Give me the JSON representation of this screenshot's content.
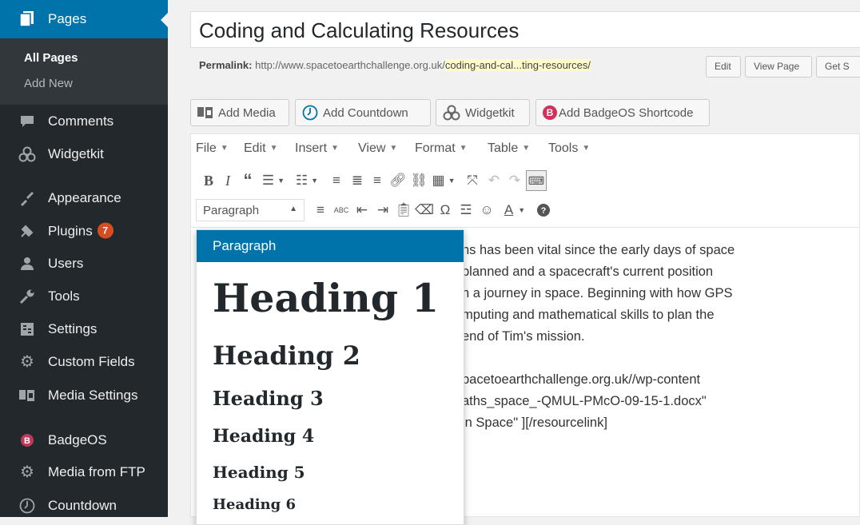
{
  "sidebar": {
    "pages_label": "Pages",
    "submenu": {
      "all_pages": "All Pages",
      "add_new": "Add New"
    },
    "items": [
      {
        "label": "Comments",
        "icon": "comments-icon"
      },
      {
        "label": "Widgetkit",
        "icon": "widgetkit-icon"
      },
      {
        "label": "Appearance",
        "icon": "appearance-icon"
      },
      {
        "label": "Plugins",
        "icon": "plugins-icon",
        "badge": "7"
      },
      {
        "label": "Users",
        "icon": "users-icon"
      },
      {
        "label": "Tools",
        "icon": "tools-icon"
      },
      {
        "label": "Settings",
        "icon": "settings-icon"
      },
      {
        "label": "Custom Fields",
        "icon": "gear-icon"
      },
      {
        "label": "Media Settings",
        "icon": "media-icon"
      },
      {
        "label": "BadgeOS",
        "icon": "badgeos-icon"
      },
      {
        "label": "Media from FTP",
        "icon": "gear-icon"
      },
      {
        "label": "Countdown",
        "icon": "clock-icon"
      }
    ]
  },
  "editor": {
    "title": "Coding and Calculating Resources",
    "permalink_label": "Permalink:",
    "permalink_base": "http://www.spacetoearthchallenge.org.uk/",
    "permalink_slug": "coding-and-cal...ting-resources/",
    "buttons": {
      "edit": "Edit",
      "view_page": "View Page",
      "get_shortlink": "Get S"
    },
    "media_buttons": {
      "add_media": "Add Media",
      "add_countdown": "Add Countdown",
      "widgetkit": "Widgetkit",
      "add_badgeos": "Add BadgeOS Shortcode"
    },
    "menubar": [
      "File",
      "Edit",
      "Insert",
      "View",
      "Format",
      "Table",
      "Tools"
    ],
    "format_value": "Paragraph",
    "content_lines": [
      "hs has been vital since the early days of space",
      "planned and a spacecraft's current position",
      "h a journey in space. Beginning with how GPS",
      "mputing and mathematical skills to plan the",
      "end of Tim's mission.",
      "",
      "pacetoearthchallenge.org.uk//wp-content",
      "aths_space_-QMUL-PMcO-09-15-1.docx\"",
      "in Space\" ][/resourcelink]"
    ]
  },
  "dropdown": {
    "paragraph": "Paragraph",
    "h1": "Heading 1",
    "h2": "Heading 2",
    "h3": "Heading 3",
    "h4": "Heading 4",
    "h5": "Heading 5",
    "h6": "Heading 6"
  },
  "colors": {
    "sidebar_bg": "#23282d",
    "accent": "#0073aa",
    "badge": "#d54e21"
  }
}
